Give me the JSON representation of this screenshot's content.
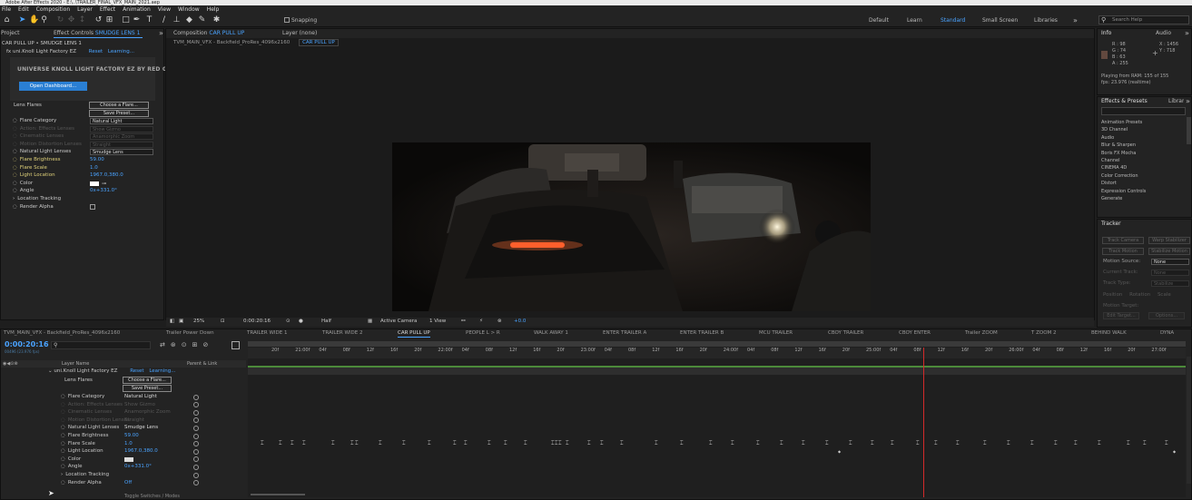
{
  "window": {
    "title": "Adobe After Effects 2020 - E:\\..\\TRAILER_FINAL_VFX_MAIN_2021.aep"
  },
  "menu": [
    "File",
    "Edit",
    "Composition",
    "Layer",
    "Effect",
    "Animation",
    "View",
    "Window",
    "Help"
  ],
  "toolbar": {
    "snapping_label": "Snapping",
    "workspaces": [
      "Default",
      "Learn",
      "Standard",
      "Small Screen",
      "Libraries"
    ],
    "active_workspace": "Standard",
    "search_placeholder": "Search Help"
  },
  "effect_controls": {
    "project_tab": "Project",
    "tab_label": "Effect Controls",
    "tab_layer": "SMUDGE LENS 1",
    "breadcrumb": "CAR PULL UP • SMUDGE LENS 1",
    "effect_name": "uni.Knoll Light Factory EZ",
    "reset": "Reset",
    "learning": "Learning...",
    "banner": "UNIVERSE KNOLL LIGHT FACTORY EZ BY RED GIANT",
    "open_dashboard": "Open Dashboard...",
    "lens_flares_label": "Lens Flares",
    "choose_flare": "Choose a Flare...",
    "save_preset": "Save Preset...",
    "props": [
      {
        "name": "Flare Category",
        "value": "Natural Light",
        "type": "dropdown",
        "dim": false
      },
      {
        "name": "Action: Effects Lenses",
        "value": "Show Gizmo",
        "type": "dropdown",
        "dim": true
      },
      {
        "name": "Cinematic Lenses",
        "value": "Anamorphic Zoom",
        "type": "dropdown",
        "dim": true
      },
      {
        "name": "Motion Distortion Lenses",
        "value": "Straight",
        "type": "dropdown",
        "dim": true
      },
      {
        "name": "Natural Light Lenses",
        "value": "Smudge Lens",
        "type": "dropdown",
        "dim": false
      },
      {
        "name": "Flare Brightness",
        "value": "59.00",
        "type": "value",
        "dim": false
      },
      {
        "name": "Flare Scale",
        "value": "1.0",
        "type": "value",
        "dim": false
      },
      {
        "name": "Light Location",
        "value": "1967.0,380.0",
        "type": "value",
        "dim": false
      },
      {
        "name": "Color",
        "value": "",
        "type": "color",
        "dim": false
      },
      {
        "name": "Angle",
        "value": "0x+331.0°",
        "type": "value",
        "dim": false
      },
      {
        "name": "Location Tracking",
        "value": "",
        "type": "group",
        "dim": false
      },
      {
        "name": "Render Alpha",
        "value": "",
        "type": "checkbox",
        "dim": false
      }
    ]
  },
  "composition": {
    "tab_label": "Composition",
    "tab_name": "CAR PULL UP",
    "tab_layer": "Layer (none)",
    "breadcrumb1": "TVM_MAIN_VFX - Backfield_ProRes_4096x2160",
    "breadcrumb2": "CAR PULL UP",
    "zoom": "25%",
    "timecode": "0:00:20:16",
    "resolution": "Half",
    "camera": "Active Camera",
    "view": "1 View",
    "exposure": "+0.0"
  },
  "info": {
    "tab": "Info",
    "audio_tab": "Audio",
    "r": "R : 98",
    "g": "G : 74",
    "b": "B : 63",
    "a": "A : 255",
    "x": "X : 1456",
    "y": "Y : 718",
    "playing1": "Playing from RAM: 155 of 155",
    "playing2": "fps: 23.976 (realtime)"
  },
  "effects_presets": {
    "tab": "Effects & Presets",
    "lib_tab": "Librar",
    "items": [
      "Animation Presets",
      "3D Channel",
      "Audio",
      "Blur & Sharpen",
      "Boris FX Mocha",
      "Channel",
      "CINEMA 4D",
      "Color Correction",
      "Distort",
      "Expression Controls",
      "Generate"
    ]
  },
  "tracker": {
    "tab": "Tracker",
    "buttons": [
      "Track Camera",
      "Warp Stabilizer",
      "Track Motion",
      "Stabilize Motion"
    ],
    "motion_source_label": "Motion Source:",
    "motion_source_value": "None",
    "current_track_label": "Current Track:",
    "current_track_value": "None",
    "track_type_label": "Track Type:",
    "track_type_value": "Stabilize",
    "options": [
      "Position",
      "Rotation",
      "Scale"
    ],
    "motion_target": "Motion Target:",
    "edit_target": "Edit Target...",
    "options_btn": "Options..."
  },
  "timeline": {
    "tabs": [
      "TVM_MAIN_VFX - Backfield_ProRes_4096x2160",
      "Trailer Power Down",
      "TRAILER WIDE 1",
      "TRAILER WIDE 2",
      "CAR PULL UP",
      "PEOPLE L > R",
      "WALK AWAY 1",
      "ENTER TRAILER A",
      "ENTER TRAILER B",
      "MCU TRAILER",
      "CBOY TRAILER",
      "CBOY ENTER",
      "Trailer ZOOM",
      "T ZOOM 2",
      "BEHIND WALK",
      "DYNA"
    ],
    "active_tab": "CAR PULL UP",
    "timecode": "0:00:20:16",
    "fps": "00496 (23.976 fps)",
    "layer_name_header": "Layer Name",
    "parent_header": "Parent & Link",
    "effect_name": "uni.Knoll Light Factory EZ",
    "reset": "Reset",
    "learning": "Learning...",
    "lens_flares": "Lens Flares",
    "choose_flare": "Choose a Flare...",
    "save_preset": "Save Preset...",
    "props": [
      {
        "name": "Flare Category",
        "value": "Natural Light"
      },
      {
        "name": "Action: Effects Lenses",
        "value": "Show Gizmo"
      },
      {
        "name": "Cinematic Lenses",
        "value": "Anamorphic Zoom"
      },
      {
        "name": "Motion Distortion Lenses",
        "value": "Straight"
      },
      {
        "name": "Natural Light Lenses",
        "value": "Smudge Lens"
      },
      {
        "name": "Flare Brightness",
        "value": "59.00"
      },
      {
        "name": "Flare Scale",
        "value": "1.0"
      },
      {
        "name": "Light Location",
        "value": "1967.0,380.0"
      },
      {
        "name": "Color",
        "value": ""
      },
      {
        "name": "Angle",
        "value": "0x+331.0°"
      },
      {
        "name": "Location Tracking",
        "value": ""
      },
      {
        "name": "Render Alpha",
        "value": "Off"
      }
    ],
    "ruler": [
      "20f",
      "21:00f",
      "04f",
      "08f",
      "12f",
      "16f",
      "20f",
      "22:00f",
      "04f",
      "08f",
      "12f",
      "16f",
      "20f",
      "23:00f",
      "04f",
      "08f",
      "12f",
      "16f",
      "20f",
      "24:00f",
      "04f",
      "08f",
      "12f",
      "16f",
      "20f",
      "25:00f",
      "04f",
      "08f",
      "12f",
      "16f",
      "20f",
      "26:00f",
      "04f",
      "08f",
      "12f",
      "16f",
      "20f",
      "27:00f"
    ],
    "toggle_label": "Toggle Switches / Modes",
    "playhead_fraction": 0.72
  }
}
